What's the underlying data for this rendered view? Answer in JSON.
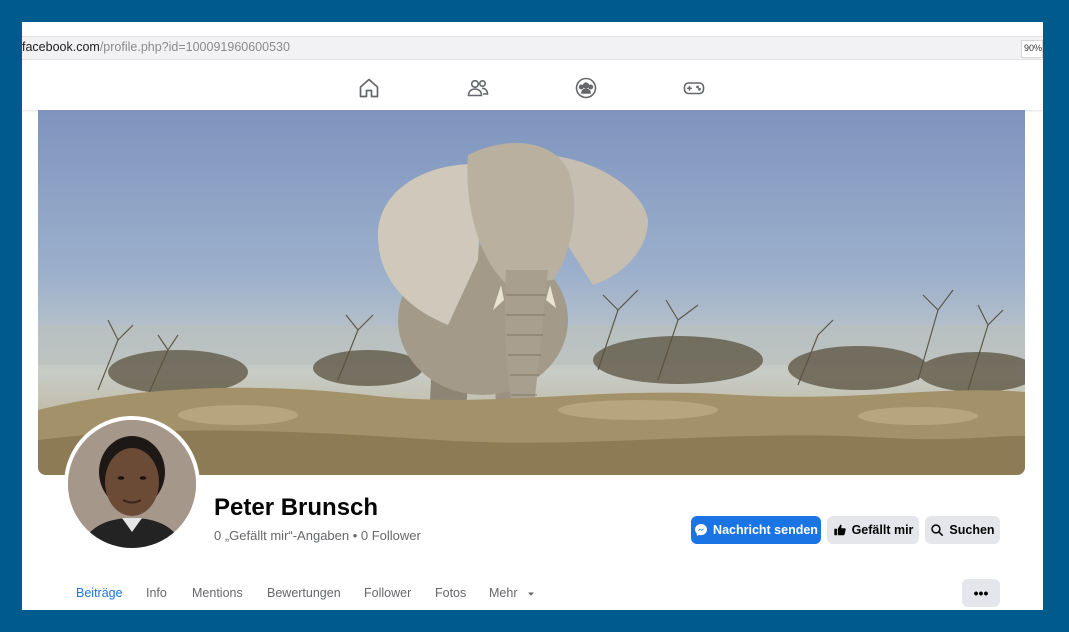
{
  "browser": {
    "url_host": "facebook.com",
    "url_path": "/profile.php?id=100091960600530",
    "zoom": "90%"
  },
  "nav": {
    "icons": [
      "home-icon",
      "friends-icon",
      "groups-icon",
      "gaming-icon"
    ]
  },
  "profile": {
    "name": "Peter Brunsch",
    "stats": "0 „Gefällt mir“-Angaben • 0 Follower"
  },
  "actions": {
    "message": "Nachricht senden",
    "like": "Gefällt mir",
    "search": "Suchen"
  },
  "tabs": [
    {
      "label": "Beiträge",
      "active": true
    },
    {
      "label": "Info"
    },
    {
      "label": "Mentions"
    },
    {
      "label": "Bewertungen"
    },
    {
      "label": "Follower"
    },
    {
      "label": "Fotos"
    },
    {
      "label": "Mehr"
    }
  ],
  "more_menu": "•••",
  "colors": {
    "primary": "#1b74e4",
    "frame": "#005a8c"
  }
}
